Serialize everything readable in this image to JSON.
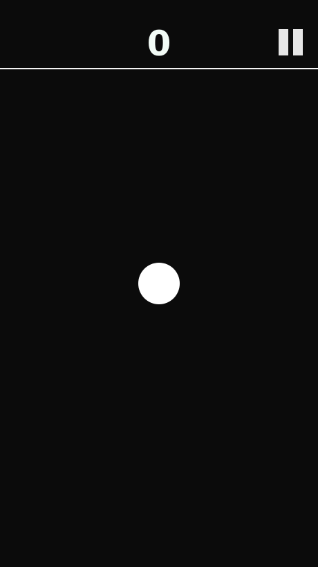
{
  "hud": {
    "score": "0",
    "pause_icon": "pause-icon"
  },
  "colors": {
    "background": "#0b0b0b",
    "score": "#f2fbf6",
    "pause": "#e6e6e6",
    "divider": "#f4f4f4",
    "ball": "#ffffff"
  }
}
